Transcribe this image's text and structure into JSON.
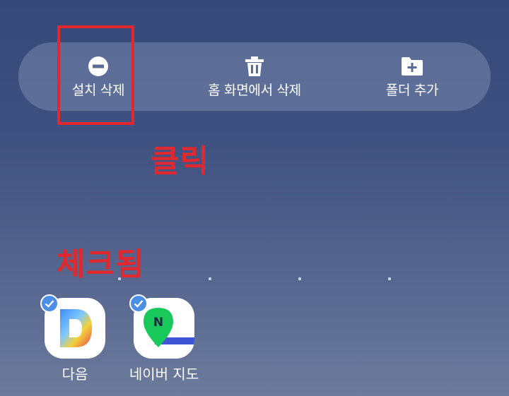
{
  "action_bar": {
    "uninstall_label": "설치 삭제",
    "remove_home_label": "홈 화면에서 삭제",
    "add_folder_label": "폴더 추가"
  },
  "annotations": {
    "click": "클릭",
    "checked": "체크됨"
  },
  "apps": [
    {
      "name": "다음",
      "selected": true,
      "icon": "daum-app-icon"
    },
    {
      "name": "네이버 지도",
      "selected": true,
      "icon": "naver-map-app-icon"
    }
  ],
  "colors": {
    "annotation": "#e0282e",
    "check_badge": "#4a8ee8"
  }
}
